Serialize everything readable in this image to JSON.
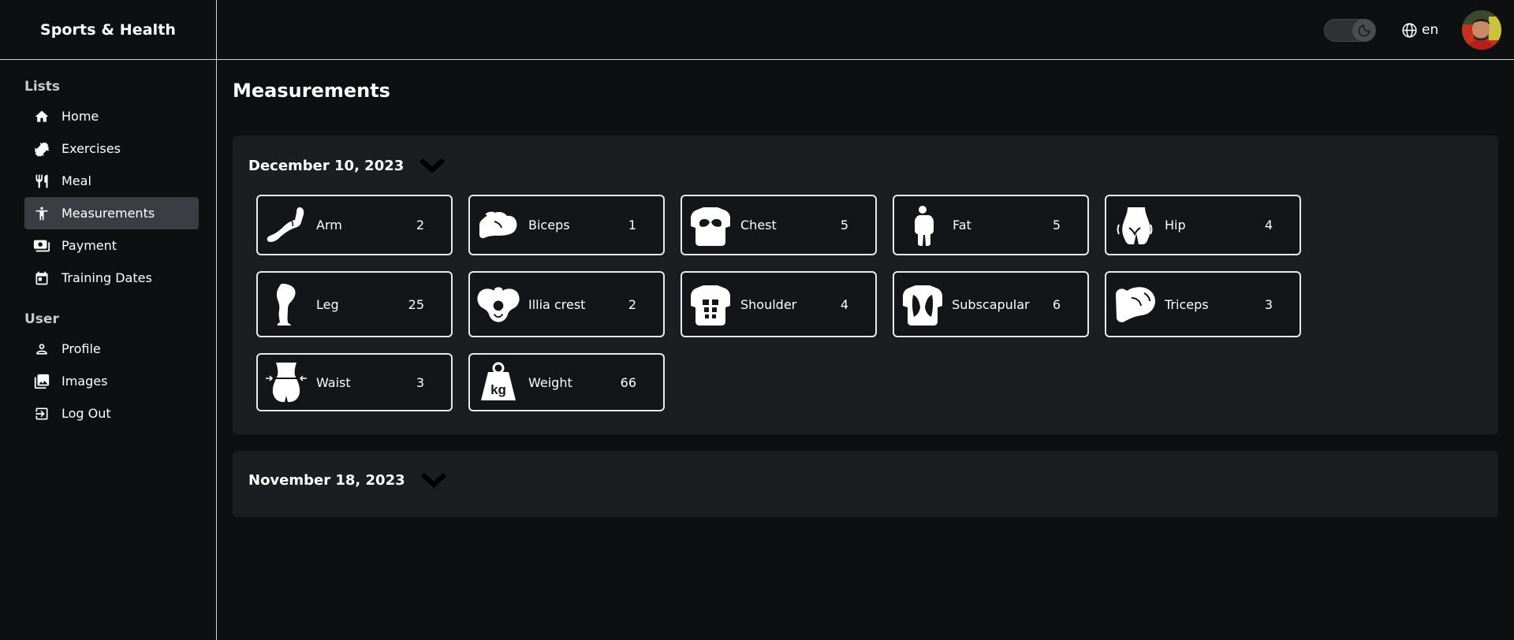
{
  "app": {
    "title": "Sports & Health"
  },
  "sidebar": {
    "sections": [
      {
        "title": "Lists",
        "items": [
          {
            "label": "Home",
            "icon": "home-icon"
          },
          {
            "label": "Exercises",
            "icon": "dumbbell-icon"
          },
          {
            "label": "Meal",
            "icon": "fork-knife-icon"
          },
          {
            "label": "Measurements",
            "icon": "person-icon",
            "active": true
          },
          {
            "label": "Payment",
            "icon": "payment-icon"
          },
          {
            "label": "Training Dates",
            "icon": "calendar-icon"
          }
        ]
      },
      {
        "title": "User",
        "items": [
          {
            "label": "Profile",
            "icon": "profile-icon"
          },
          {
            "label": "Images",
            "icon": "images-icon"
          },
          {
            "label": "Log Out",
            "icon": "logout-icon"
          }
        ]
      }
    ]
  },
  "topbar": {
    "theme_toggle": {
      "icon": "moon-icon",
      "state": "dark"
    },
    "language": {
      "label": "en",
      "icon": "globe-icon"
    },
    "avatar": {
      "icon": "avatar-icon"
    }
  },
  "main": {
    "title": "Measurements",
    "groups": [
      {
        "date": "December 10, 2023",
        "expanded": true,
        "measurements": [
          {
            "label": "Arm",
            "value": "2",
            "icon": "arm-icon"
          },
          {
            "label": "Biceps",
            "value": "1",
            "icon": "biceps-icon"
          },
          {
            "label": "Chest",
            "value": "5",
            "icon": "chest-icon"
          },
          {
            "label": "Fat",
            "value": "5",
            "icon": "fat-icon"
          },
          {
            "label": "Hip",
            "value": "4",
            "icon": "hip-icon"
          },
          {
            "label": "Leg",
            "value": "25",
            "icon": "leg-icon"
          },
          {
            "label": "Illia crest",
            "value": "2",
            "icon": "pelvis-icon"
          },
          {
            "label": "Shoulder",
            "value": "4",
            "icon": "shoulder-icon"
          },
          {
            "label": "Subscapular",
            "value": "6",
            "icon": "back-icon"
          },
          {
            "label": "Triceps",
            "value": "3",
            "icon": "triceps-icon"
          },
          {
            "label": "Waist",
            "value": "3",
            "icon": "waist-icon"
          },
          {
            "label": "Weight",
            "value": "66",
            "icon": "weight-icon",
            "icon_text": "kg"
          }
        ]
      },
      {
        "date": "November 18, 2023",
        "expanded": false,
        "measurements": []
      }
    ]
  },
  "colors": {
    "background": "#0e0f11",
    "panel": "#1b1d20",
    "active_nav": "#3b3d43",
    "border": "#e8e9eb",
    "text": "#ffffff"
  }
}
